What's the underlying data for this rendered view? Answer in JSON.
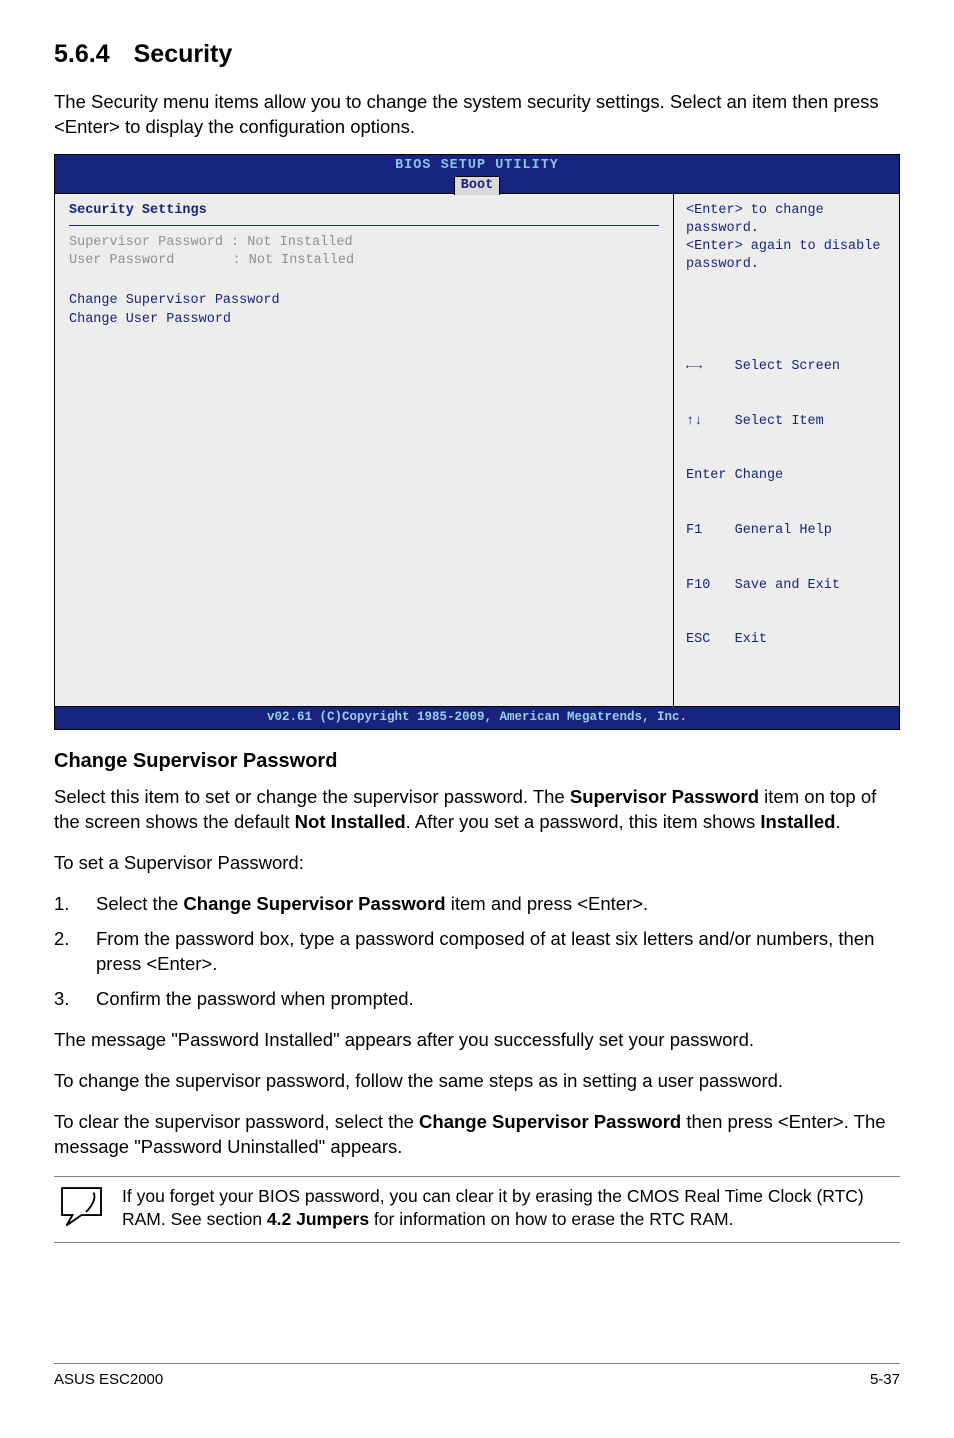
{
  "heading": {
    "num": "5.6.4",
    "text": "Security"
  },
  "intro": "The Security menu items allow you to change the system security settings. Select an item then press <Enter> to display the configuration options.",
  "bios": {
    "headerTitle": "BIOS SETUP UTILITY",
    "tab": "Boot",
    "left": {
      "sectionTitle": "Security Settings",
      "supLabel": "Supervisor Password",
      "supVal": ": Not Installed",
      "userLabel": "User Password",
      "userVal": ": Not Installed",
      "changeSup": "Change Supervisor Password",
      "changeUser": "Change User Password"
    },
    "right": {
      "hint1": "<Enter> to change password.",
      "hint2": "<Enter> again to disable password.",
      "k_lr": "←→",
      "v_lr": "Select Screen",
      "k_ud": "↑↓",
      "v_ud": "Select Item",
      "k_enter": "Enter",
      "v_enter": "Change",
      "k_f1": "F1",
      "v_f1": "General Help",
      "k_f10": "F10",
      "v_f10": "Save and Exit",
      "k_esc": "ESC",
      "v_esc": "Exit"
    },
    "footer": "v02.61 (C)Copyright 1985-2009, American Megatrends, Inc."
  },
  "h3": "Change Supervisor Password",
  "p1a": "Select this item to set or change the supervisor password. The ",
  "p1b": "Supervisor Password",
  "p1c": " item on top of the screen shows the default ",
  "p1d": "Not Installed",
  "p1e": ". After you set a password, this item shows ",
  "p1f": "Installed",
  "p1g": ".",
  "p2": "To set a Supervisor Password:",
  "ol": {
    "n1": "1.",
    "t1a": "Select the ",
    "t1b": "Change Supervisor Password",
    "t1c": " item and press <Enter>.",
    "n2": "2.",
    "t2": "From the password box, type a password composed of at least six letters and/or numbers, then press <Enter>.",
    "n3": "3.",
    "t3": "Confirm the password when prompted."
  },
  "p3": "The message \"Password Installed\" appears after you successfully set your password.",
  "p4": "To change the supervisor password, follow the same steps as in setting a user password.",
  "p5a": "To clear the supervisor password, select the ",
  "p5b": "Change Supervisor Password",
  "p5c": " then press <Enter>. The message \"Password Uninstalled\" appears.",
  "note_a": "If you forget your BIOS password, you can clear it by erasing the CMOS Real Time Clock (RTC) RAM. See section ",
  "note_b": "4.2 Jumpers",
  "note_c": " for information on how to erase the RTC RAM.",
  "footer": {
    "left": "ASUS ESC2000",
    "right": "5-37"
  }
}
